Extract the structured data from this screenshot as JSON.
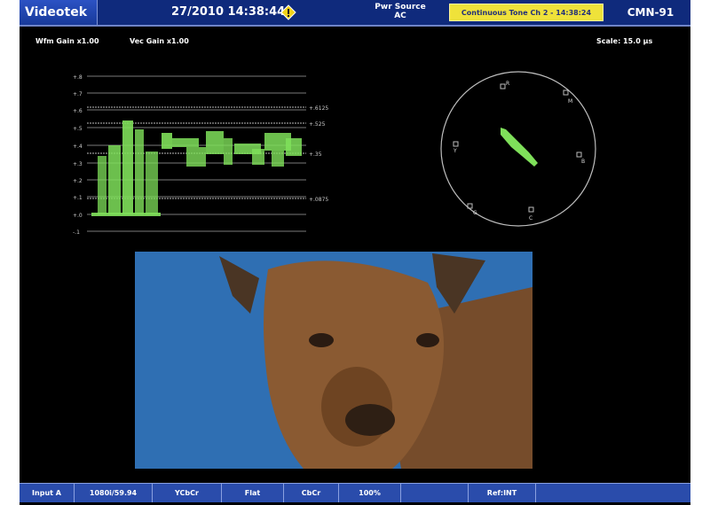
{
  "header": {
    "logo": "Videotek",
    "datetime": "27/2010 14:38:44",
    "power_source_label": "Pwr Source",
    "power_source_value": "AC",
    "alarm": "Continuous Tone Ch 2 - 14:38:24",
    "model": "CMN-91",
    "warning_icon": "warning-icon"
  },
  "info": {
    "wfm_gain": "Wfm Gain x1.00",
    "vec_gain": "Vec Gain x1.00",
    "scale": "Scale: 15.0 µs"
  },
  "waveform": {
    "y_ticks": [
      "+.8",
      "+.7",
      "+.6",
      "+.5",
      "+.4",
      "+.3",
      "+.2",
      "+.1",
      "+.0",
      "-.1"
    ],
    "ref_labels": [
      "+.6125",
      "+.525",
      "+.35",
      "+.0875"
    ]
  },
  "vectorscope": {
    "targets": [
      "R",
      "M",
      "B",
      "C",
      "G",
      "Y"
    ]
  },
  "status_bar": [
    "Input A",
    "1080i/59.94",
    "YCbCr",
    "Flat",
    "CbCr",
    "100%",
    "",
    "Ref:INT",
    ""
  ],
  "colors": {
    "trace": "#7fe05a",
    "bar": "#2a4cab",
    "alarm": "#efe23a"
  }
}
